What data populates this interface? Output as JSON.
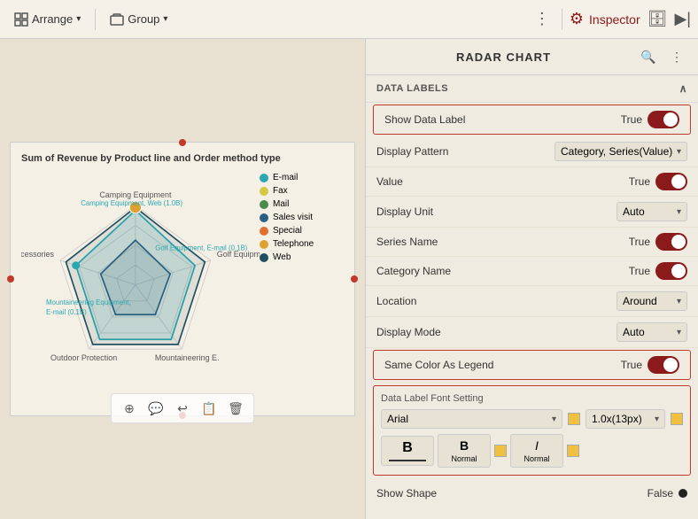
{
  "topbar": {
    "arrange_label": "Arrange",
    "group_label": "Group",
    "inspector_label": "Inspector",
    "more_symbol": "⋮"
  },
  "chart": {
    "title": "Sum of Revenue by Product line and Order method type",
    "axis_labels": [
      "Camping Equipment",
      "Golf Equipment",
      "Mountaineering Equipment",
      "Outdoor Protection",
      "Accessories"
    ],
    "annotations": [
      "Camping Equipment, Web (1.0B)",
      "Golf Equipment, E-mail (0.1B)",
      "Mountaineering Equipment, E-mail (0.1B)"
    ],
    "legend": [
      {
        "label": "E-mail",
        "color": "#2aa8b0"
      },
      {
        "label": "Fax",
        "color": "#d4c840"
      },
      {
        "label": "Mail",
        "color": "#4a8a4a"
      },
      {
        "label": "Sales visit",
        "color": "#2a6080"
      },
      {
        "label": "Special",
        "color": "#e07030"
      },
      {
        "label": "Telephone",
        "color": "#e0a030"
      },
      {
        "label": "Web",
        "color": "#205060"
      }
    ]
  },
  "inspector": {
    "title": "RADAR CHART",
    "section_data_labels": "DATA LABELS",
    "show_data_label_label": "Show Data Label",
    "show_data_label_value": "True",
    "display_pattern_label": "Display Pattern",
    "display_pattern_value": "Category, Series(Value)",
    "value_label": "Value",
    "value_value": "True",
    "display_unit_label": "Display Unit",
    "display_unit_value": "Auto",
    "series_name_label": "Series Name",
    "series_name_value": "True",
    "category_name_label": "Category Name",
    "category_name_value": "True",
    "location_label": "Location",
    "location_value": "Around",
    "display_mode_label": "Display Mode",
    "display_mode_value": "Auto",
    "same_color_label": "Same Color As Legend",
    "same_color_value": "True",
    "font_setting_title": "Data Label Font Setting",
    "font_name": "Arial",
    "font_size": "1.0x(13px)",
    "style_bold_label": "B",
    "style_italic_label": "I",
    "style_normal_label": "Normal",
    "style_italic_display": "Normal",
    "show_shape_label": "Show Shape",
    "show_shape_value": "False"
  },
  "toolbar": {
    "tools": [
      "⊕",
      "💬",
      "↩",
      "📋",
      "🗑"
    ]
  }
}
